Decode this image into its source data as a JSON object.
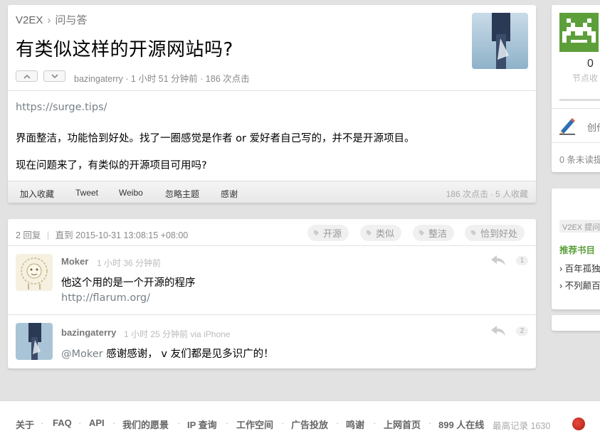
{
  "breadcrumb": {
    "home": "V2EX",
    "separator": "›",
    "node": "问与答"
  },
  "topic": {
    "title": "有类似这样的开源网站吗?",
    "author": "bazingaterry",
    "meta_rest": " · 1 小时 51 分钟前 · 186 次点击",
    "link": "https://surge.tips/",
    "paragraph1": "界面整洁，功能恰到好处。找了一圈感觉是作者 or 爱好者自己写的，并不是开源项目。",
    "paragraph2": "现在问题来了，有类似的开源项目可用吗?",
    "footer_actions": [
      "加入收藏",
      "Tweet",
      "Weibo",
      "忽略主题",
      "感谢"
    ],
    "footer_stats": "186 次点击 ∙ 5 人收藏"
  },
  "replies_header": {
    "count": "2 回复",
    "divider": "|",
    "last": "直到 2015-10-31 13:08:15 +08:00",
    "tags": [
      "开源",
      "类似",
      "整洁",
      "恰到好处"
    ]
  },
  "replies": [
    {
      "user": "Moker",
      "time": "1 小时 36 分钟前",
      "text": "他这个用的是一个开源的程序",
      "link": "http://flarum.org/",
      "floor": "1"
    },
    {
      "user": "bazingaterry",
      "time": "1 小时 25 分钟前 via iPhone",
      "mention": "@Moker",
      "text": " 感谢感谢， v 友们都是见多识广的！",
      "floor": "2"
    }
  ],
  "sidebar": {
    "count": "0",
    "count_label": "节点收",
    "create": "创作",
    "unread": "0 条未读提",
    "tag": "V2EX 提问指",
    "rec_title": "推荐书目",
    "rec_items": [
      "› 百年孤独",
      "› 不列颠百"
    ]
  },
  "footer": {
    "links": [
      "关于",
      "FAQ",
      "API",
      "我们的愿景",
      "IP 查询",
      "工作空间",
      "广告投放",
      "鸣谢",
      "上网首页"
    ],
    "online": "899 人在线",
    "record": "最高记录 1630",
    "dot": "·"
  },
  "colors": {
    "accent_green": "#5c9f3a",
    "link_gray": "#778087",
    "background": "#e2e2e2"
  }
}
